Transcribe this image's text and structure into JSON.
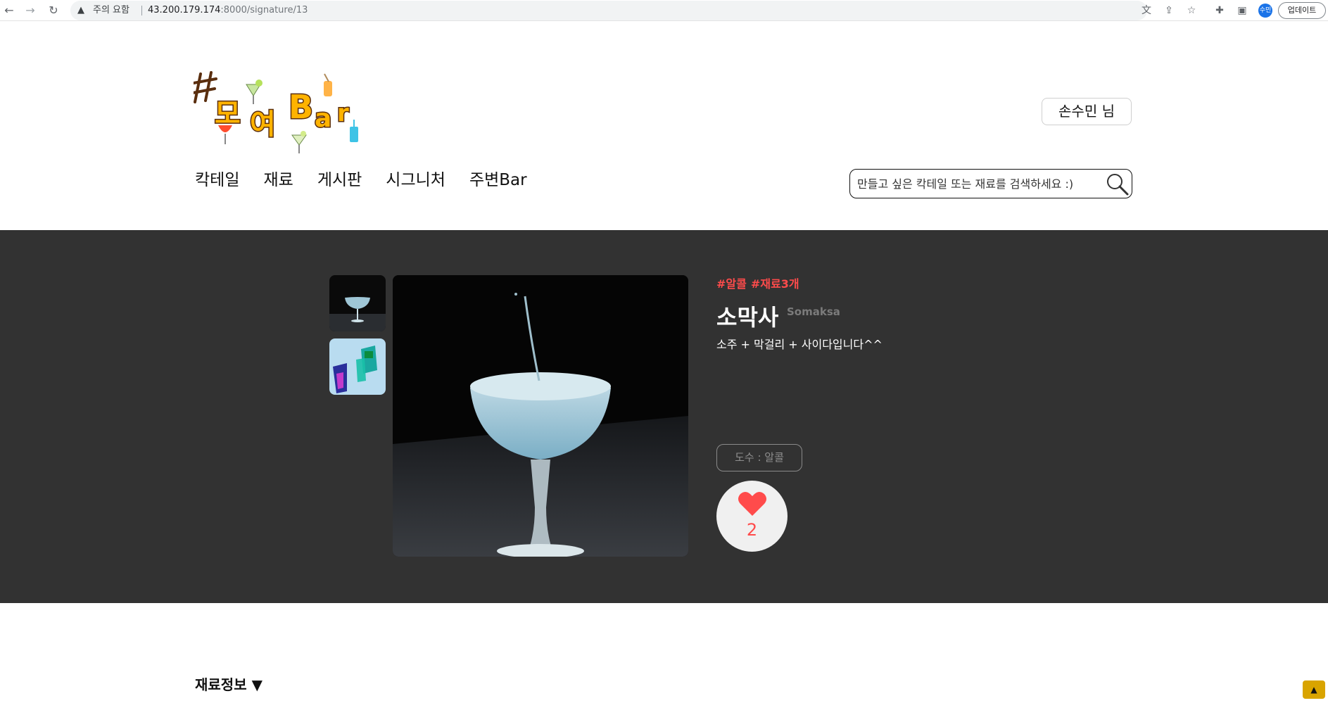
{
  "browser": {
    "warning_label": "주의 요함",
    "url_host": "43.200.179.174",
    "url_path": ":8000/signature/13",
    "profile_initials": "수민",
    "update_label": "업데이트"
  },
  "header": {
    "user_label": "손수민 님",
    "nav": [
      "칵테일",
      "재료",
      "게시판",
      "시그니처",
      "주변Bar"
    ],
    "search_placeholder": "만들고 싶은 칵테일 또는 재료를 검색하세요 :)"
  },
  "cocktail": {
    "tags": [
      "#알콜",
      "#재료3개"
    ],
    "name": "소막사",
    "english_name": "Somaksa",
    "description": "소주 + 막걸리 + 사이다입니다^^",
    "abv_label": "도수 : 알콜",
    "like_count": "2"
  },
  "section": {
    "ingredients_title": "재료정보 ▼"
  },
  "colors": {
    "hero_bg": "#323232",
    "accent_red": "#ff4b4b",
    "top_button": "#d9a400"
  }
}
